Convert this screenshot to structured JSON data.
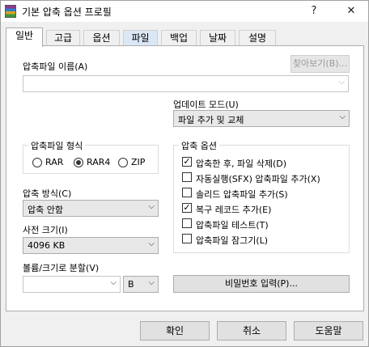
{
  "window": {
    "title": "기본 압축 옵션 프로필"
  },
  "title_buttons": {
    "help": "?",
    "close": "✕"
  },
  "tabs": [
    {
      "label": "일반"
    },
    {
      "label": "고급"
    },
    {
      "label": "옵션"
    },
    {
      "label": "파일"
    },
    {
      "label": "백업"
    },
    {
      "label": "날짜"
    },
    {
      "label": "설명"
    }
  ],
  "archive_name": {
    "label": "압축파일 이름(A)",
    "browse_button": "찾아보기(B)...",
    "value": ""
  },
  "update_mode": {
    "label": "업데이트 모드(U)",
    "value": "파일 추가 및 교체"
  },
  "archive_format": {
    "label": "압축파일 형식",
    "options": [
      {
        "label": "RAR",
        "selected": false
      },
      {
        "label": "RAR4",
        "selected": true
      },
      {
        "label": "ZIP",
        "selected": false
      }
    ]
  },
  "compression_method": {
    "label": "압축 방식(C)",
    "value": "압축 안함"
  },
  "dictionary_size": {
    "label": "사전 크기(I)",
    "value": "4096 KB"
  },
  "split": {
    "label": "볼륨/크기로 분할(V)",
    "value": "",
    "unit": "B"
  },
  "archive_options": {
    "label": "압축 옵션",
    "items": [
      {
        "label": "압축한 후, 파일 삭제(D)",
        "checked": true
      },
      {
        "label": "자동실행(SFX) 압축파일 추가(X)",
        "checked": false
      },
      {
        "label": "솔리드 압축파일 추가(S)",
        "checked": false
      },
      {
        "label": "복구 레코드 추가(E)",
        "checked": true
      },
      {
        "label": "압축파일 테스트(T)",
        "checked": false
      },
      {
        "label": "압축파일 잠그기(L)",
        "checked": false
      }
    ]
  },
  "password_button": "비밀번호 입력(P)...",
  "footer": {
    "ok": "확인",
    "cancel": "취소",
    "help": "도움말"
  }
}
